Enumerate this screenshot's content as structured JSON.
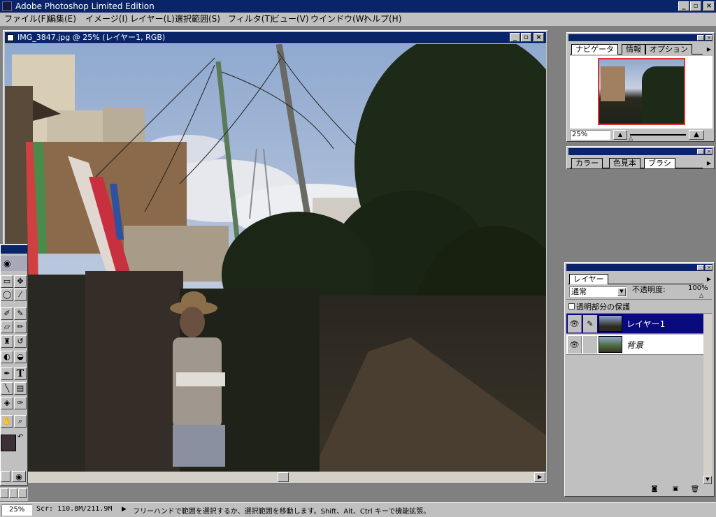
{
  "app": {
    "title": "Adobe Photoshop Limited Edition",
    "controls": {
      "minimize": "_",
      "maximize": "▫",
      "close": "×"
    }
  },
  "menu": [
    {
      "label": "ファイル(F)"
    },
    {
      "label": "編集(E)"
    },
    {
      "label": "イメージ(I)"
    },
    {
      "label": "レイヤー(L)"
    },
    {
      "label": "選択範囲(S)"
    },
    {
      "label": "フィルタ(T)"
    },
    {
      "label": "ビュー(V)"
    },
    {
      "label": "ウインドウ(W)"
    },
    {
      "label": "ヘルプ(H)"
    }
  ],
  "document": {
    "title": "IMG_3847.jpg @ 25% (レイヤー1, RGB)"
  },
  "navigator": {
    "tabs": [
      "ナビゲータ",
      "情報",
      "オプション"
    ],
    "zoom": "25%"
  },
  "color_panel": {
    "tabs": [
      "カラー",
      "色見本",
      "ブラシ"
    ]
  },
  "layers": {
    "tab": "レイヤー",
    "blend_mode": "通常",
    "opacity_label": "不透明度:",
    "opacity_value": "100%",
    "preserve_label": "透明部分の保護",
    "items": [
      {
        "name": "レイヤー1",
        "selected": true
      },
      {
        "name": "背景",
        "selected": false
      }
    ]
  },
  "status": {
    "zoom": "25%",
    "scratch": "Scr: 110.8M/211.9M",
    "message": "フリーハンドで範囲を選択するか、選択範囲を移動します。Shift、Alt、Ctrl キーで機能拡張。"
  },
  "tools": {
    "text_tool": "T"
  },
  "colors": {
    "title_bar": "#0a246a",
    "chrome": "#c0c0c0",
    "workspace": "#808080",
    "foreground": "#3a3035"
  }
}
